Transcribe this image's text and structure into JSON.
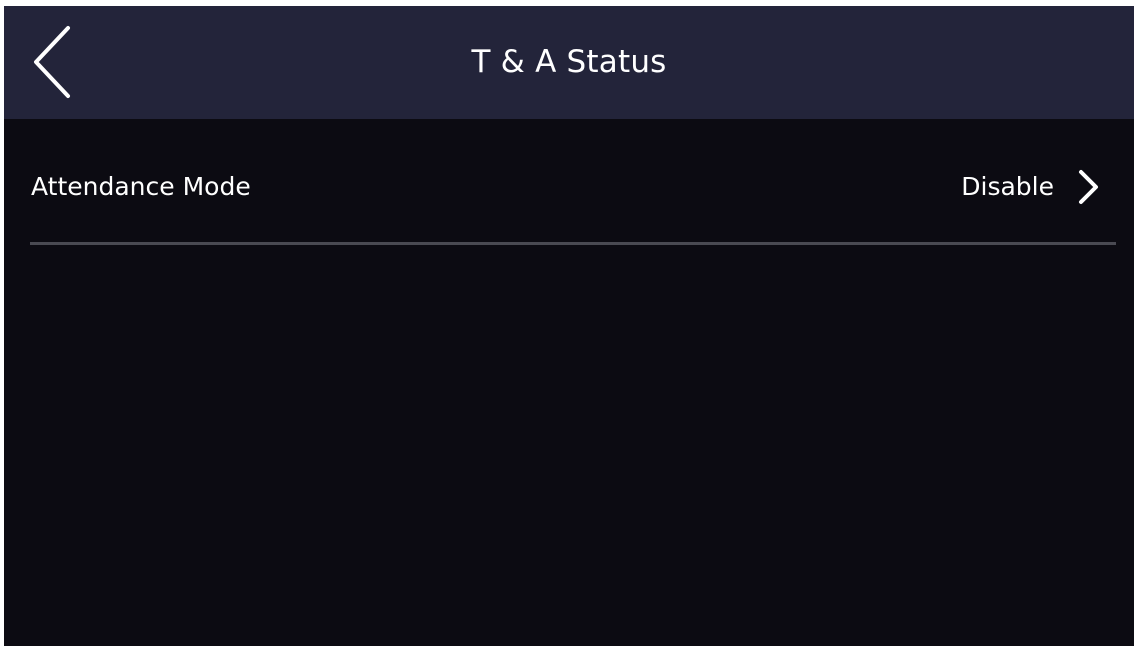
{
  "header": {
    "title": "T & A Status",
    "back_icon": "chevron-left-icon"
  },
  "settings": {
    "attendance_mode": {
      "label": "Attendance Mode",
      "value": "Disable",
      "icon": "chevron-right-icon"
    }
  },
  "colors": {
    "header_background": "#23243a",
    "screen_background": "#0c0b12",
    "text": "#ffffff",
    "divider": "#4a4a52"
  }
}
